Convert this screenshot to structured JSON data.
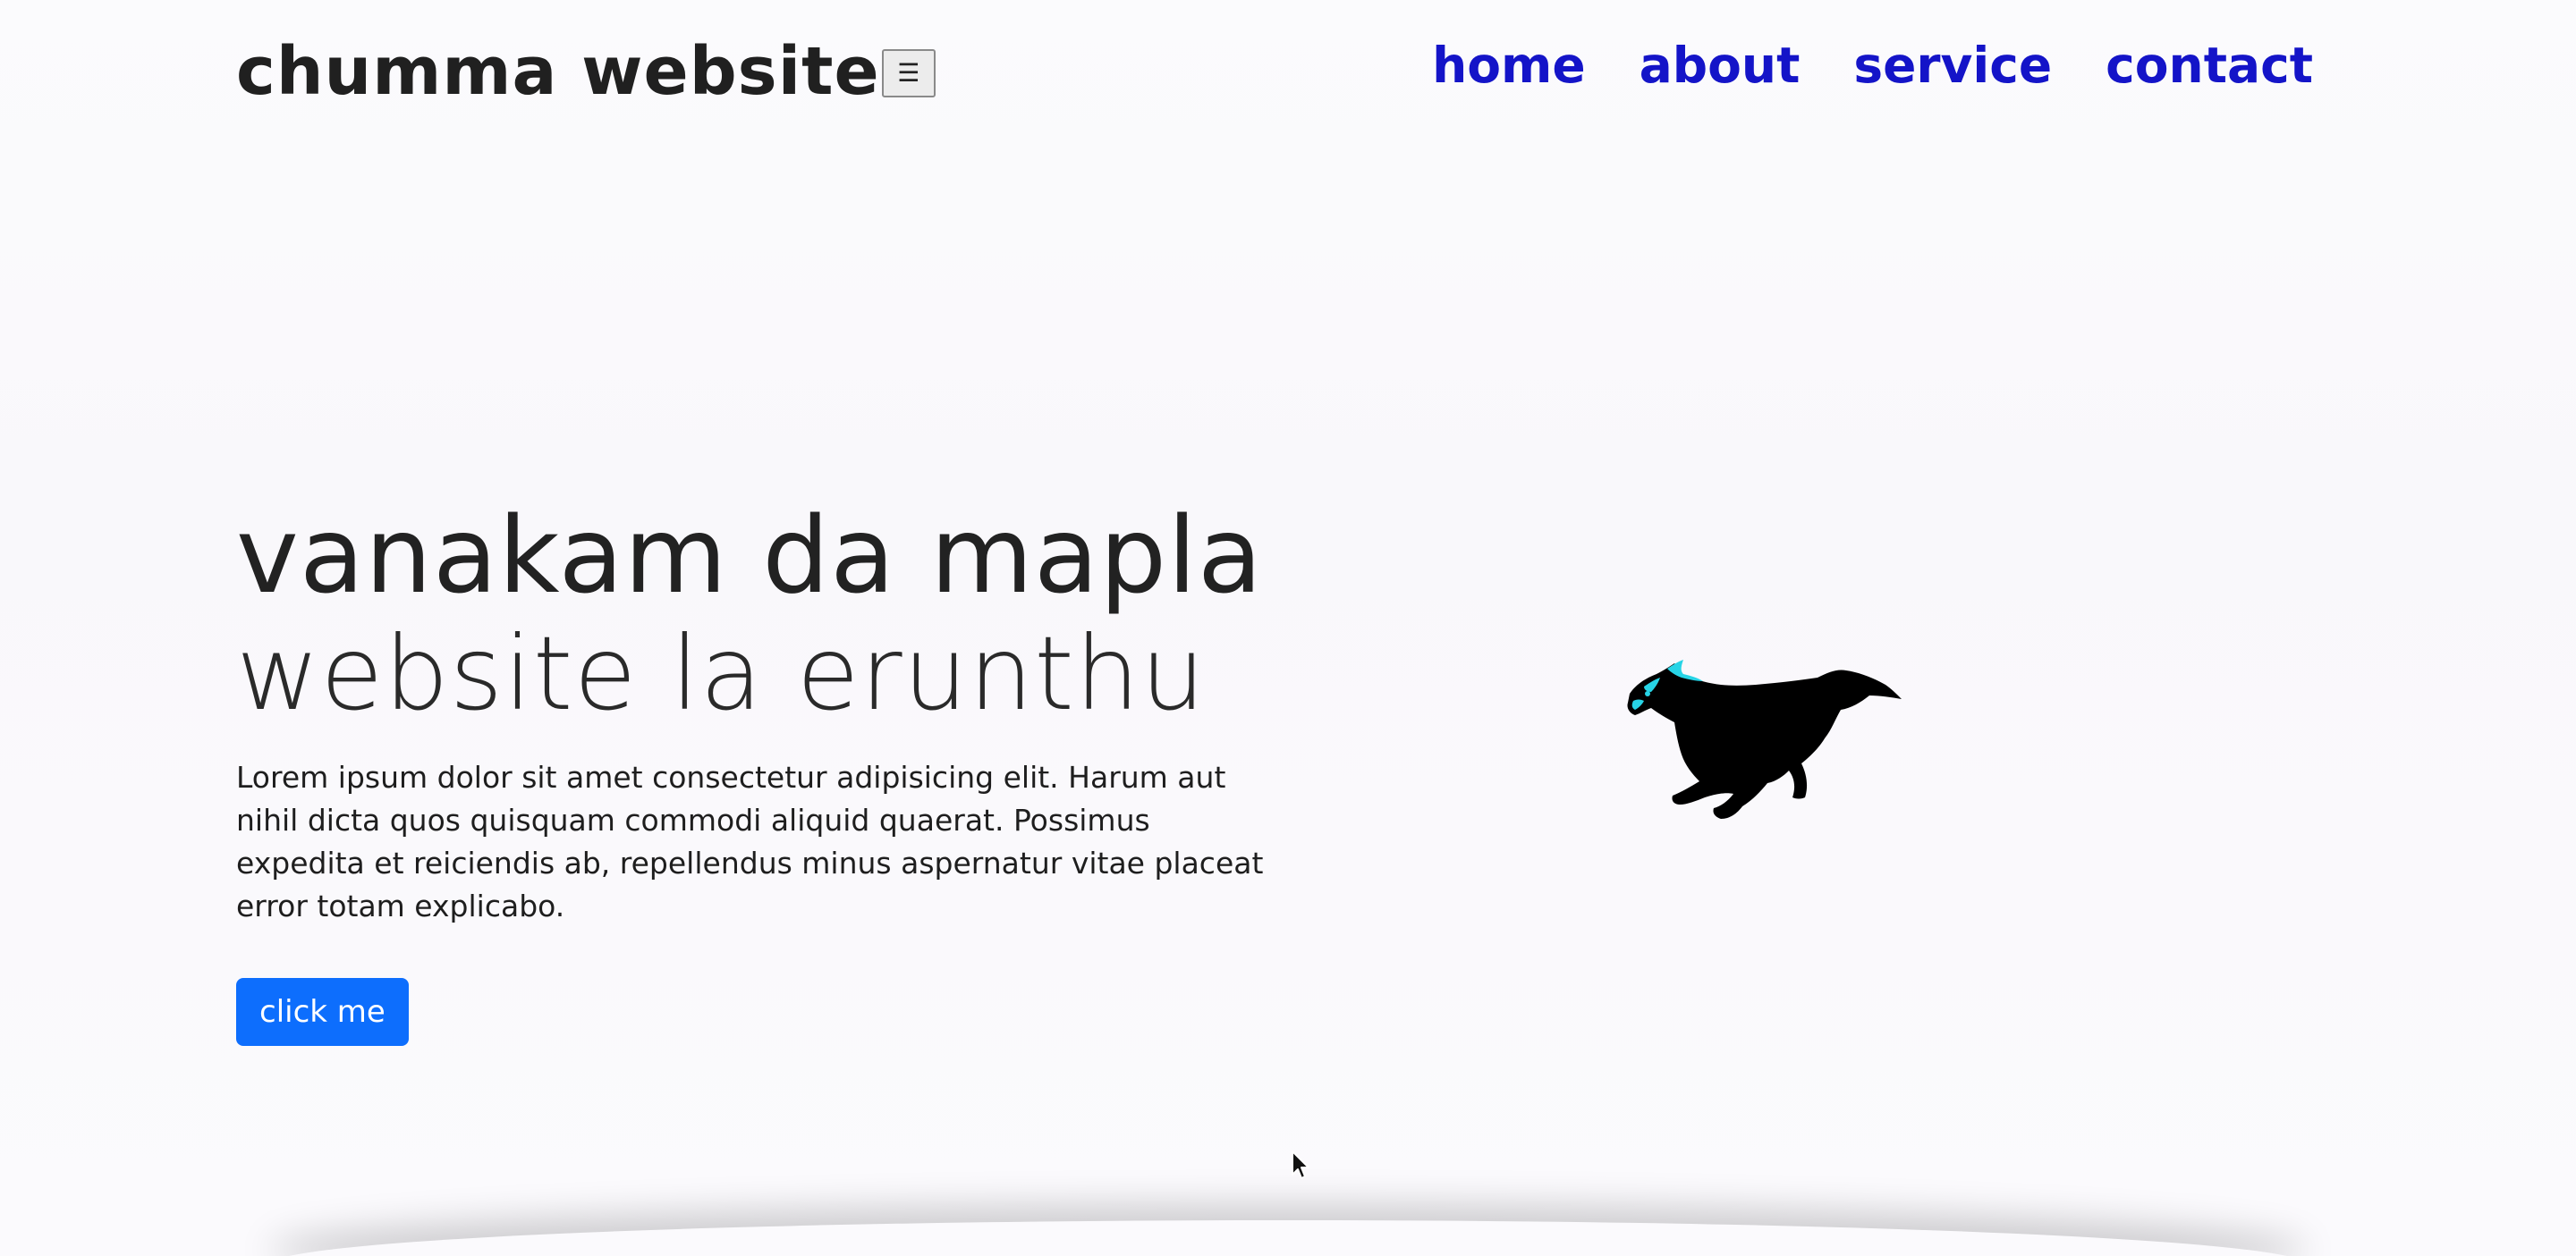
{
  "header": {
    "brand": "chumma website",
    "menu_toggle_glyph": "☰",
    "nav": [
      {
        "label": "home"
      },
      {
        "label": "about"
      },
      {
        "label": "service"
      },
      {
        "label": "contact"
      }
    ]
  },
  "hero": {
    "title": "vanakam da mapla",
    "subtitle": "website la erunthu",
    "body": "Lorem ipsum dolor sit amet consectetur adipisicing elit. Harum aut nihil dicta quos quisquam commodi aliquid quaerat. Possimus expedita et reiciendis ab, repellendus minus aspernatur vitae placeat error totam explicabo.",
    "button_label": "click me",
    "image_icon": "running-horse-icon"
  },
  "colors": {
    "nav_link": "#1414c8",
    "button_bg": "#0d6efd",
    "button_text": "#ffffff",
    "horse_mane": "#27d4e6",
    "background": "#fbfafd"
  }
}
